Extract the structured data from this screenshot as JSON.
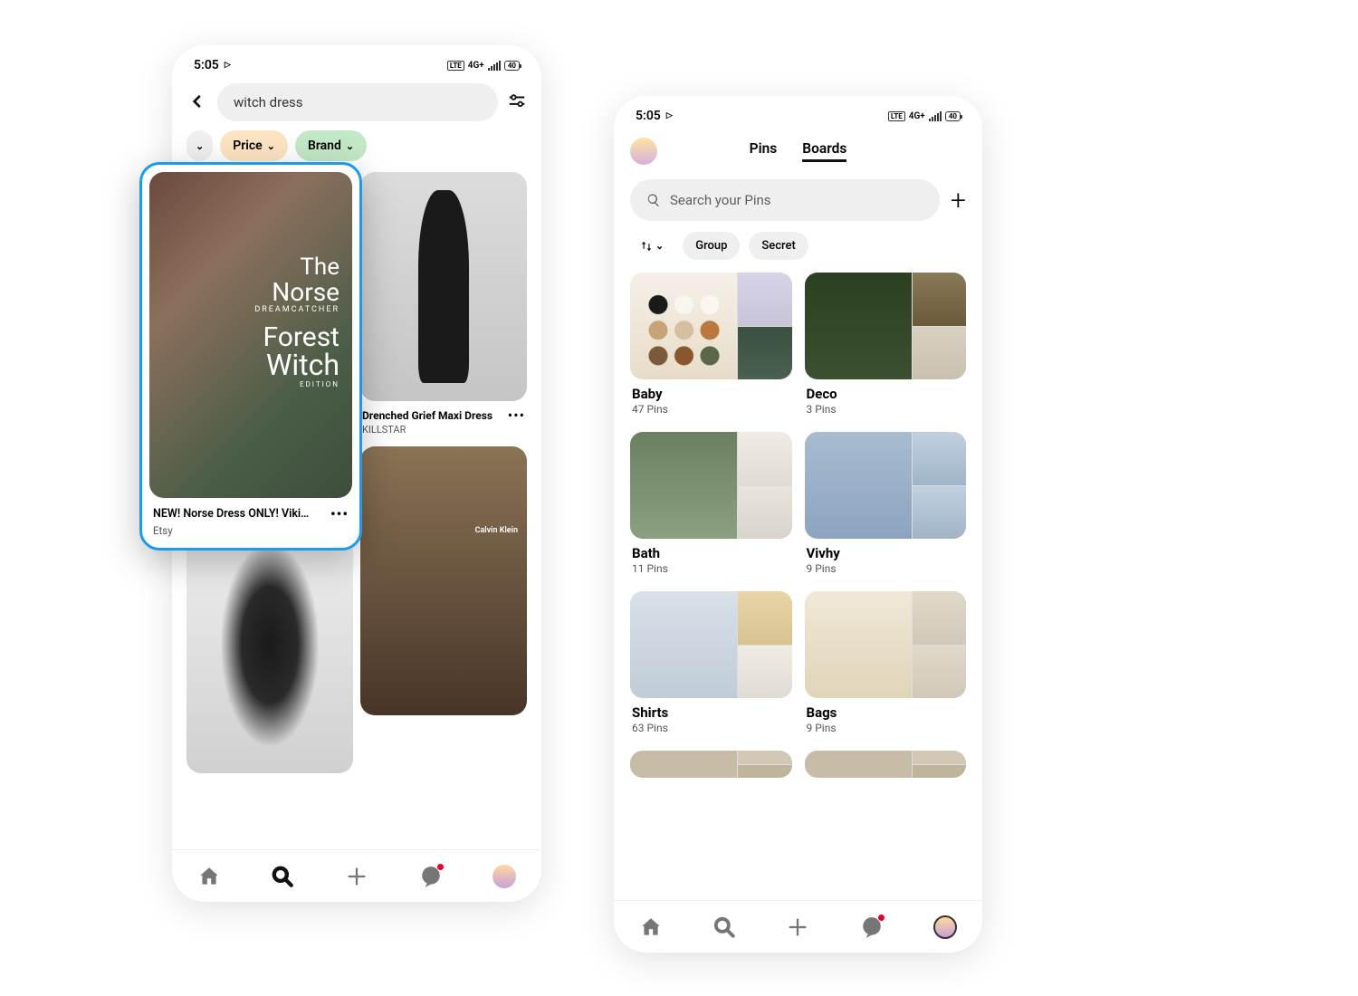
{
  "status": {
    "time": "5:05",
    "net": "LTE",
    "net2": "4G+",
    "battery": "40"
  },
  "left": {
    "search_value": "witch dress",
    "chips": {
      "price": "Price",
      "brand": "Brand"
    },
    "hero_pin": {
      "line1": "The",
      "line2": "Norse",
      "line3": "DREAMCATCHER",
      "line4": "Forest",
      "line5": "Witch",
      "line6": "EDITION",
      "title": "NEW! Norse Dress ONLY! Viki…",
      "shop": "Etsy",
      "more": "•••"
    },
    "pin2": {
      "title": "Drenched Grief Maxi Dress",
      "shop": "KILLSTAR",
      "more": "•••"
    },
    "pin3_overlay": "Calvin Klein"
  },
  "right": {
    "tabs": {
      "pins": "Pins",
      "boards": "Boards"
    },
    "search_placeholder": "Search your Pins",
    "filters": {
      "group": "Group",
      "secret": "Secret"
    },
    "boards": [
      {
        "name": "Baby",
        "count": "47 Pins",
        "cls": "bc-baby"
      },
      {
        "name": "Deco",
        "count": "3 Pins",
        "cls": "bc-deco"
      },
      {
        "name": "Bath",
        "count": "11 Pins",
        "cls": "bc-bath"
      },
      {
        "name": "Vivhy",
        "count": "9 Pins",
        "cls": "bc-vivhy"
      },
      {
        "name": "Shirts",
        "count": "63 Pins",
        "cls": "bc-shirts"
      },
      {
        "name": "Bags",
        "count": "9 Pins",
        "cls": "bc-bags"
      }
    ]
  }
}
